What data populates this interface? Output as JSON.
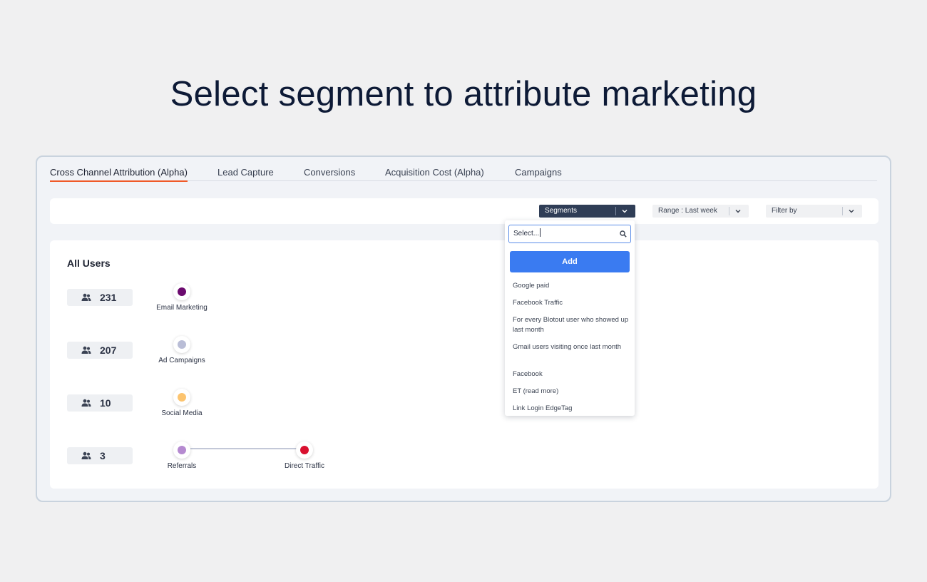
{
  "headline": "Select segment to attribute marketing",
  "tabs": [
    {
      "label": "Cross Channel Attribution (Alpha)",
      "active": true
    },
    {
      "label": "Lead Capture",
      "active": false
    },
    {
      "label": "Conversions",
      "active": false
    },
    {
      "label": "Acquisition Cost (Alpha)",
      "active": false
    },
    {
      "label": "Campaigns",
      "active": false
    }
  ],
  "toolbar": {
    "segments_label": "Segments",
    "range_label": "Range : Last week",
    "filter_label": "Filter by"
  },
  "panel": {
    "title": "All Users",
    "rows": [
      {
        "count": "231",
        "nodes": [
          {
            "label": "Email Marketing",
            "color": "#6b0a6e"
          }
        ]
      },
      {
        "count": "207",
        "nodes": [
          {
            "label": "Ad Campaigns",
            "color": "#b9bdd6"
          }
        ]
      },
      {
        "count": "10",
        "nodes": [
          {
            "label": "Social Media",
            "color": "#fcc46f"
          }
        ]
      },
      {
        "count": "3",
        "nodes": [
          {
            "label": "Referrals",
            "color": "#b58ad0"
          },
          {
            "label": "Direct Traffic",
            "color": "#d9102f"
          }
        ]
      }
    ]
  },
  "dropdown": {
    "search_value": "Select...",
    "add_label": "Add",
    "options": [
      "Google paid",
      "Facebook Traffic",
      "For every Blotout user who showed up last month",
      "Gmail users visiting once last month",
      "Facebook",
      "ET (read more)",
      "Link Login EdgeTag"
    ]
  },
  "colors": {
    "accent_tab": "#f05a28",
    "add_button": "#3a7bf1",
    "segments_select": "#2f3d56"
  }
}
